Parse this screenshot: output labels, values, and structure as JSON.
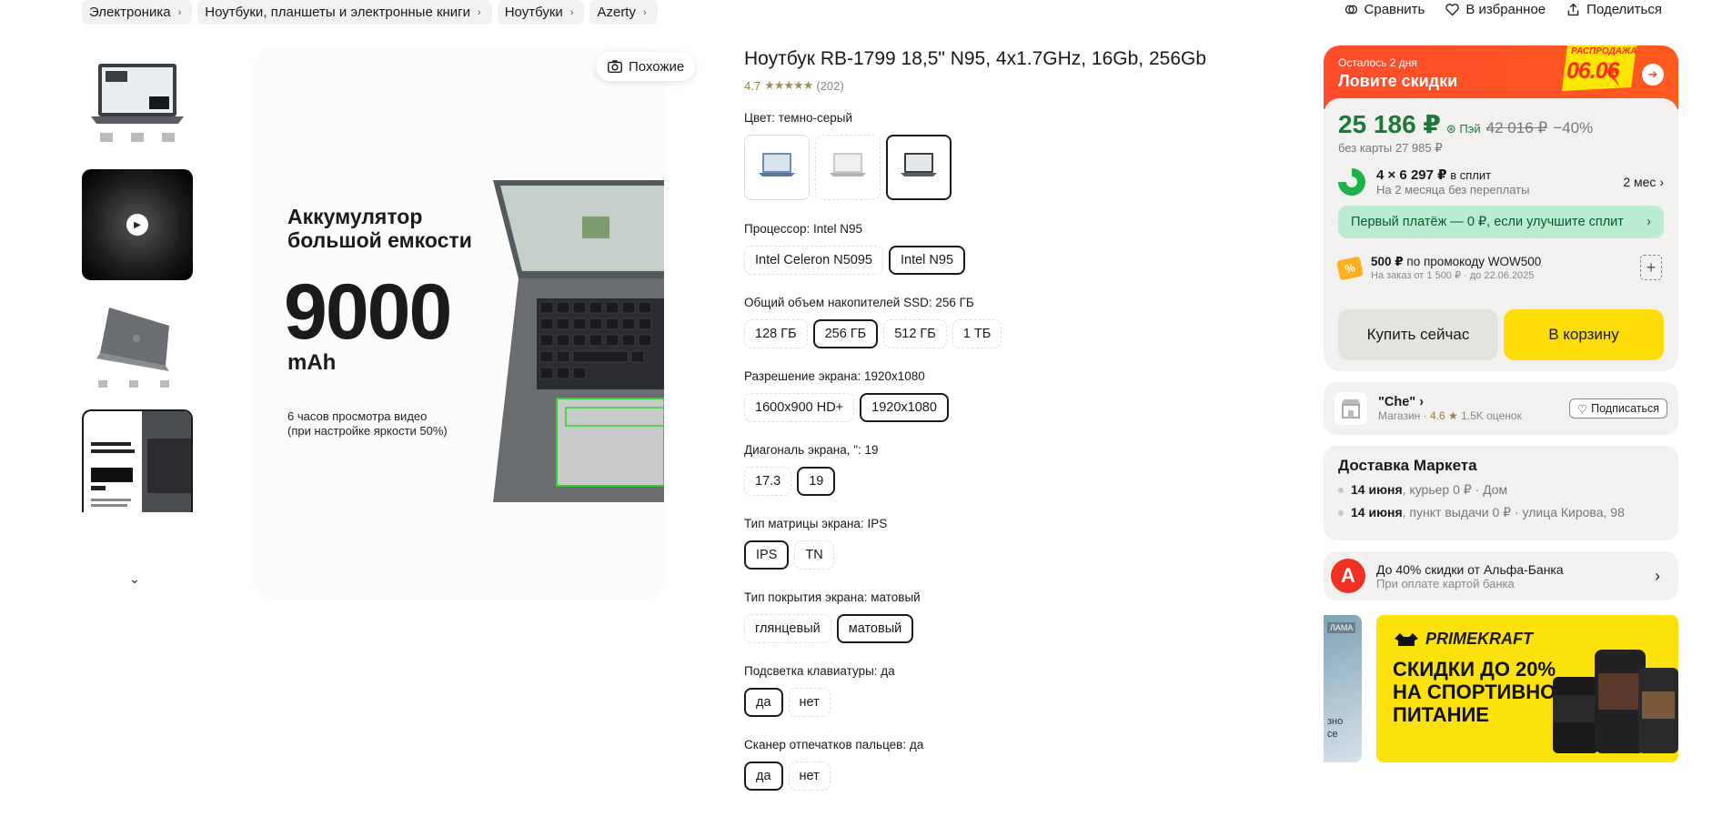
{
  "breadcrumbs": [
    "Электроника",
    "Ноутбуки, планшеты и электронные книги",
    "Ноутбуки",
    "Azerty"
  ],
  "top_actions": {
    "compare": "Сравнить",
    "favorite": "В избранное",
    "share": "Поделиться"
  },
  "gallery": {
    "similar_label": "Похожие",
    "promo_heading_1": "Аккумулятор",
    "promo_heading_2": "большой емкости",
    "promo_value": "9000",
    "promo_unit": "mAh",
    "promo_sub_1": "6 часов просмотра видео",
    "promo_sub_2": "(при настройке яркости 50%)"
  },
  "product": {
    "title": "Ноутбук RB-1799 18,5\" N95, 4x1.7GHz, 16Gb, 256Gb",
    "rating": "4.7",
    "stars": "★★★★★",
    "reviews": "(202)"
  },
  "options": {
    "color": {
      "label": "Цвет: темно-серый"
    },
    "cpu": {
      "label": "Процессор: Intel N95",
      "items": [
        "Intel Celeron N5095",
        "Intel N95"
      ]
    },
    "ssd": {
      "label": "Общий объем накопителей SSD: 256 ГБ",
      "items": [
        "128 ГБ",
        "256 ГБ",
        "512 ГБ",
        "1 ТБ"
      ]
    },
    "resolution": {
      "label": "Разрешение экрана: 1920x1080",
      "items": [
        "1600x900 HD+",
        "1920x1080"
      ]
    },
    "diagonal": {
      "label": "Диагональ экрана, \": 19",
      "items": [
        "17.3",
        "19"
      ]
    },
    "matrix": {
      "label": "Тип матрицы экрана: IPS",
      "items": [
        "IPS",
        "TN"
      ]
    },
    "coating": {
      "label": "Тип покрытия экрана: матовый",
      "items": [
        "глянцевый",
        "матовый"
      ]
    },
    "backlight": {
      "label": "Подсветка клавиатуры: да",
      "items": [
        "да",
        "нет"
      ]
    },
    "fingerprint": {
      "label": "Сканер отпечатков пальцев: да",
      "items": [
        "да",
        "нет"
      ]
    }
  },
  "buy": {
    "sale_small": "Осталось 2 дня",
    "sale_big": "Ловите скидки",
    "sale_badge_top": "РАСПРОДАЖА",
    "sale_badge_date": "06.06",
    "price": "25 186 ₽",
    "pay": "Пэй",
    "old_price": "42 016 ₽",
    "discount": "−40%",
    "no_card": "без карты 27 985 ₽",
    "split_main": "4 × 6 297 ₽",
    "split_suffix": " в сплит",
    "split_sub": "На 2 месяца без переплаты",
    "split_term": "2 мес",
    "first_payment": "Первый платёж — 0 ₽, если улучшите сплит",
    "promo_main": "500 ₽",
    "promo_rest": " по промокоду WOW500",
    "promo_sub": "На заказ от 1 500 ₽ · до 22.06.2025",
    "buy_now": "Купить сейчас",
    "to_cart": "В корзину"
  },
  "shop": {
    "name": "\"Che\"",
    "type": "Магазин",
    "rating": "4.6 ★",
    "reviews": "1.5K оценок",
    "subscribe": "Подписаться"
  },
  "delivery": {
    "title": "Доставка Маркета",
    "rows": [
      {
        "date": "14 июня",
        "rest": ", курьер 0 ₽ · Дом"
      },
      {
        "date": "14 июня",
        "rest": ", пункт выдачи 0 ₽ · улица Кирова, 98"
      }
    ]
  },
  "alfa": {
    "logo": "А",
    "main": "До 40% скидки от Альфа-Банка",
    "sub": "При оплате картой банка"
  },
  "ads": {
    "left_tag": "ЛАМА",
    "left_text_1": "зно",
    "left_text_2": "сe",
    "brand": "PRIMEKRAFT",
    "headline": "Скидки до 20% на спортивное питание"
  },
  "colors": {
    "accent_green": "#1a7a3a",
    "sale_red": "#ff4c2b",
    "cart_yellow": "#fddc07",
    "rating_gold": "#a58b5e"
  }
}
